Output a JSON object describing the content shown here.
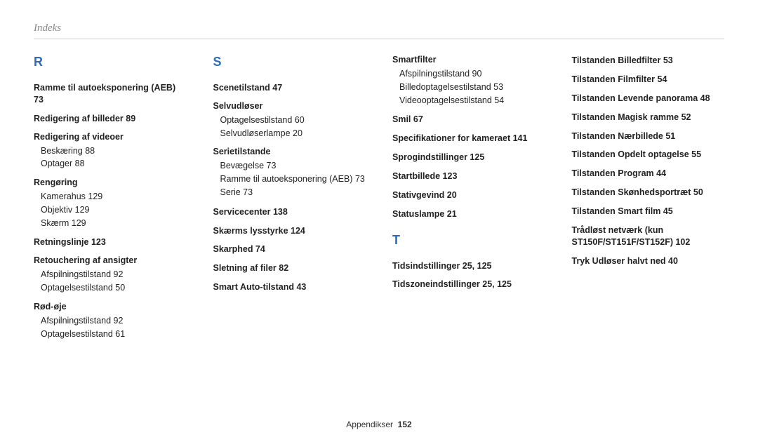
{
  "header": "Indeks",
  "footer_label": "Appendikser",
  "footer_page": "152",
  "columns": [
    {
      "letter": "R",
      "items": [
        {
          "type": "bold",
          "text": "Ramme til autoeksponering (AEB)  73"
        },
        {
          "type": "bold",
          "text": "Redigering af billeder  89"
        },
        {
          "type": "group",
          "head": "Redigering af videoer",
          "subs": [
            "Beskæring  88",
            "Optager  88"
          ]
        },
        {
          "type": "group",
          "head": "Rengøring",
          "subs": [
            "Kamerahus  129",
            "Objektiv  129",
            "Skærm  129"
          ]
        },
        {
          "type": "bold",
          "text": "Retningslinje  123"
        },
        {
          "type": "group",
          "head": "Retouchering af ansigter",
          "subs": [
            "Afspilningstilstand  92",
            "Optagelsestilstand  50"
          ]
        },
        {
          "type": "group",
          "head": "Rød-øje",
          "subs": [
            "Afspilningstilstand  92",
            "Optagelsestilstand  61"
          ]
        }
      ]
    },
    {
      "letter": "S",
      "items": [
        {
          "type": "bold",
          "text": "Scenetilstand  47"
        },
        {
          "type": "group",
          "head": "Selvudløser",
          "subs": [
            "Optagelsestilstand  60",
            "Selvudløserlampe  20"
          ]
        },
        {
          "type": "group",
          "head": "Serietilstande",
          "subs": [
            "Bevægelse  73",
            "Ramme til autoeksponering (AEB)  73",
            "Serie  73"
          ]
        },
        {
          "type": "bold",
          "text": "Servicecenter  138"
        },
        {
          "type": "bold",
          "text": "Skærms lysstyrke  124"
        },
        {
          "type": "bold",
          "text": "Skarphed  74"
        },
        {
          "type": "bold",
          "text": "Sletning af filer  82"
        },
        {
          "type": "bold",
          "text": "Smart Auto-tilstand  43"
        }
      ]
    },
    {
      "items_top": [
        {
          "type": "group",
          "head": "Smartfilter",
          "subs": [
            "Afspilningstilstand  90",
            "Billedoptagelsestilstand  53",
            "Videooptagelsestilstand  54"
          ]
        },
        {
          "type": "bold",
          "text": "Smil  67"
        },
        {
          "type": "bold",
          "text": "Specifikationer for kameraet  141"
        },
        {
          "type": "bold",
          "text": "Sprogindstillinger  125"
        },
        {
          "type": "bold",
          "text": "Startbillede  123"
        },
        {
          "type": "bold",
          "text": "Stativgevind  20"
        },
        {
          "type": "bold",
          "text": "Statuslampe  21"
        }
      ],
      "letter": "T",
      "items": [
        {
          "type": "bold",
          "text": "Tidsindstillinger  25, 125"
        },
        {
          "type": "bold",
          "text": "Tidszoneindstillinger  25, 125"
        }
      ]
    },
    {
      "items": [
        {
          "type": "bold",
          "text": "Tilstanden Billedfilter  53"
        },
        {
          "type": "bold",
          "text": "Tilstanden Filmfilter  54"
        },
        {
          "type": "bold",
          "text": "Tilstanden Levende panorama  48"
        },
        {
          "type": "bold",
          "text": "Tilstanden Magisk ramme  52"
        },
        {
          "type": "bold",
          "text": "Tilstanden Nærbillede  51"
        },
        {
          "type": "bold",
          "text": "Tilstanden Opdelt optagelse  55"
        },
        {
          "type": "bold",
          "text": "Tilstanden Program  44"
        },
        {
          "type": "bold",
          "text": "Tilstanden Skønhedsportræt  50"
        },
        {
          "type": "bold",
          "text": "Tilstanden Smart film  45"
        },
        {
          "type": "bold",
          "text": "Trådløst netværk (kun ST150F/ST151F/ST152F)  102"
        },
        {
          "type": "bold",
          "text": "Tryk Udløser halvt ned  40"
        }
      ]
    }
  ]
}
